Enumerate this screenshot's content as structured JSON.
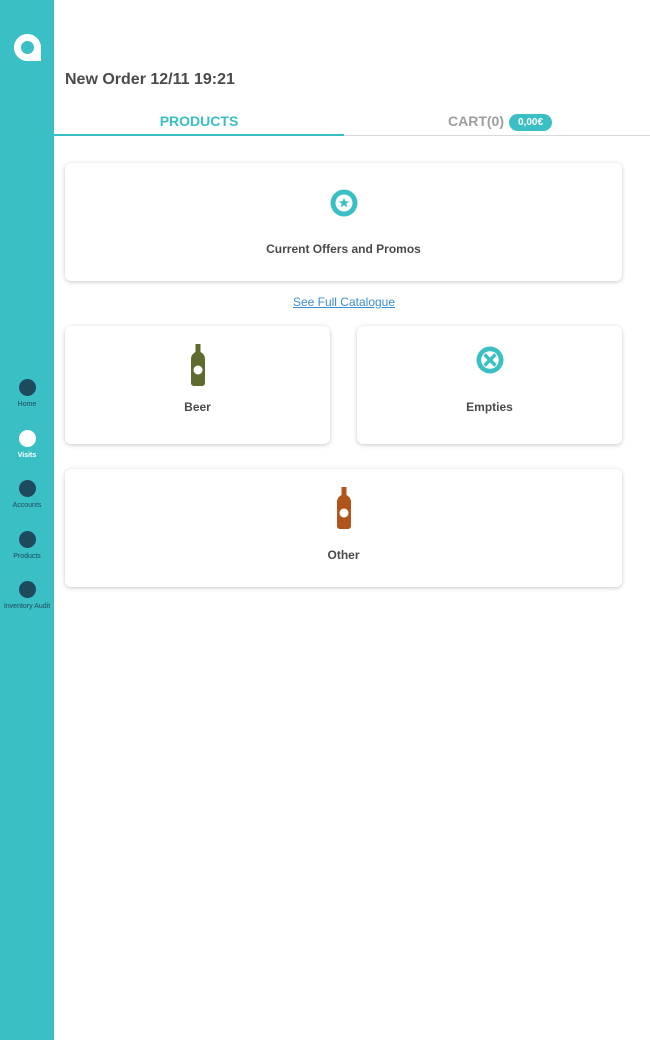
{
  "brand": {
    "primary": "#3ABFC4",
    "nav_dot": "#1E4A5E",
    "link": "#3A8FD0",
    "beer": "#5E6A2E",
    "other": "#B0541C"
  },
  "sidebar": {
    "logo_icon": "app-logo",
    "items": [
      {
        "label": "Home",
        "icon": "home-dot",
        "active": false
      },
      {
        "label": "Visits",
        "icon": "visits-dot",
        "active": true
      },
      {
        "label": "Accounts",
        "icon": "accounts-dot",
        "active": false
      },
      {
        "label": "Products",
        "icon": "products-dot",
        "active": false
      },
      {
        "label": "Inventory Audit",
        "icon": "inventory-dot",
        "active": false
      }
    ]
  },
  "header": {
    "title": "New Order 12/11 19:21"
  },
  "tabs": {
    "products": "PRODUCTS",
    "cart": "CART(0)",
    "cart_total": "0,00€"
  },
  "main": {
    "offers_card": {
      "label": "Current Offers and Promos",
      "icon": "star-badge-icon"
    },
    "catalogue_link": "See Full Catalogue",
    "categories": [
      {
        "label": "Beer",
        "icon": "beer-bottle-icon"
      },
      {
        "label": "Empties",
        "icon": "empties-icon"
      },
      {
        "label": "Other",
        "icon": "other-bottle-icon"
      }
    ]
  }
}
